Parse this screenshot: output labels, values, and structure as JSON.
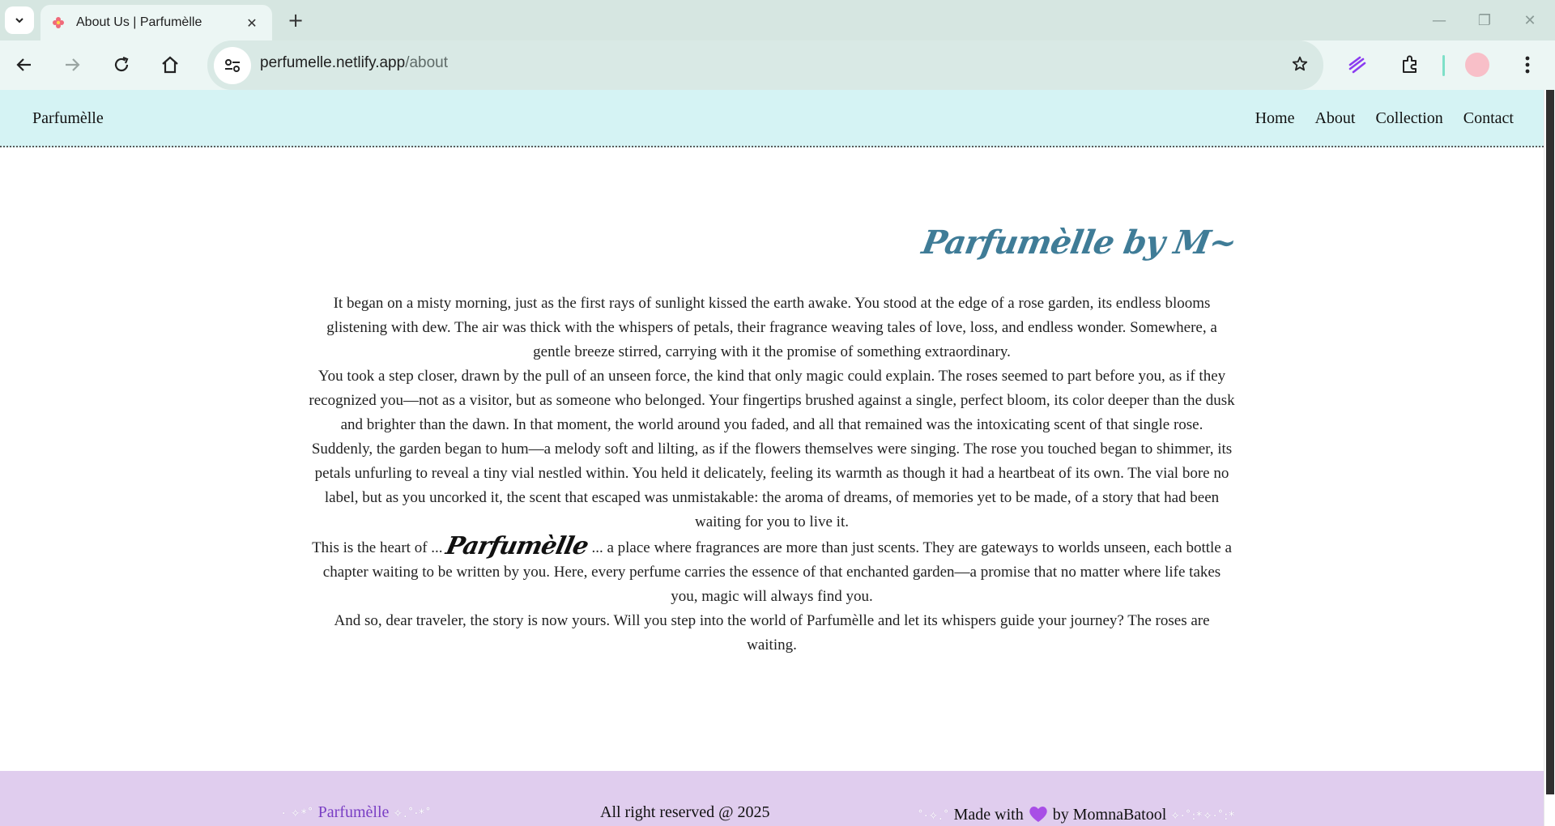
{
  "browser": {
    "tab_title": "About Us | Parfumèlle",
    "url_domain": "perfumelle.netlify.app",
    "url_path": "/about",
    "tab_close": "✕",
    "new_tab": "+",
    "minimize": "—",
    "restore": "❐",
    "close": "✕"
  },
  "site": {
    "brand": "Parfumèlle",
    "nav": [
      "Home",
      "About",
      "Collection",
      "Contact"
    ]
  },
  "about": {
    "heading": "Parfumèlle by M~",
    "paragraphs": [
      "It began on a misty morning, just as the first rays of sunlight kissed the earth awake. You stood at the edge of a rose garden, its endless blooms glistening with dew. The air was thick with the whispers of petals, their fragrance weaving tales of love, loss, and endless wonder. Somewhere, a gentle breeze stirred, carrying with it the promise of something extraordinary.",
      "You took a step closer, drawn by the pull of an unseen force, the kind that only magic could explain. The roses seemed to part before you, as if they recognized you—not as a visitor, but as someone who belonged. Your fingertips brushed against a single, perfect bloom, its color deeper than the dusk and brighter than the dawn. In that moment, the world around you faded, and all that remained was the intoxicating scent of that single rose.",
      "Suddenly, the garden began to hum—a melody soft and lilting, as if the flowers themselves were singing. The rose you touched began to shimmer, its petals unfurling to reveal a tiny vial nestled within. You held it delicately, feeling its warmth as though it had a heartbeat of its own. The vial bore no label, but as you uncorked it, the scent that escaped was unmistakable: the aroma of dreams, of memories yet to be made, of a story that had been waiting for you to live it."
    ],
    "heart_prefix": "This is the heart of ...",
    "heart_brand": "Parfumèlle",
    "heart_suffix": "... a place where fragrances are more than just scents. They are gateways to worlds unseen, each bottle a chapter waiting to be written by you. Here, every perfume carries the essence of that enchanted garden—a promise that no matter where life takes you, magic will always find you.",
    "closing": "And so, dear traveler, the story is now yours. Will you step into the world of Parfumèlle and let its whispers guide your journey? The roses are waiting."
  },
  "footer": {
    "brand": "Parfumèlle",
    "copyright": "All right reserved @ 2025",
    "made_with": "Made with",
    "by": "by MomnaBatool",
    "sparkle_left_a": "· ✧*˚",
    "sparkle_left_b": "✧.˚·*˚",
    "sparkle_right_a": "˚·✧.˚",
    "sparkle_right_b": "✧·˚:*✧·˚:*"
  },
  "colors": {
    "header_bg": "#d5f3f4",
    "footer_bg": "#e0cdee",
    "heading": "#3f7c97",
    "footer_brand": "#7a3fc4"
  }
}
